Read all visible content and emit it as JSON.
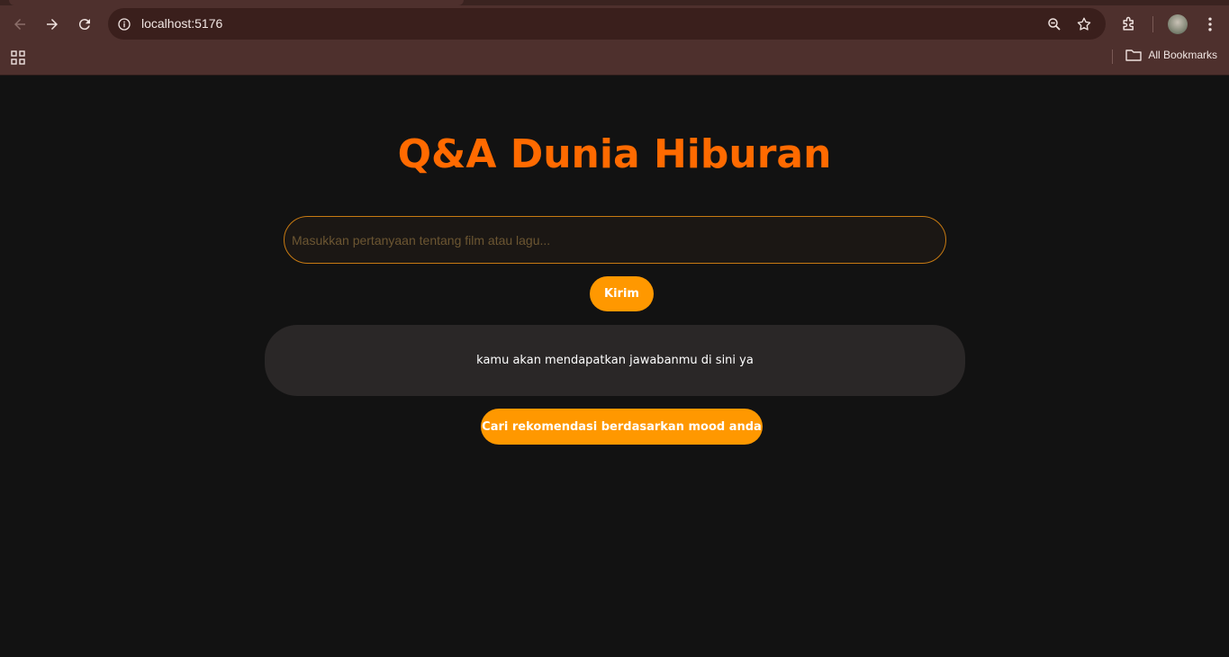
{
  "browser": {
    "url": "localhost:5176",
    "bookmarks_label": "All Bookmarks"
  },
  "page": {
    "title": "Q&A Dunia Hiburan",
    "input_placeholder": "Masukkan pertanyaan tentang film atau lagu...",
    "input_value": "",
    "send_label": "Kirim",
    "answer_text": "kamu akan mendapatkan jawabanmu di sini ya",
    "mood_button_label": "Cari rekomendasi berdasarkan mood anda"
  },
  "colors": {
    "accent": "#ff9800",
    "title": "#ff6a00",
    "background": "#121212",
    "answer_box": "#2a2727",
    "chrome": "#4e302d"
  },
  "icons": [
    "back-icon",
    "forward-icon",
    "reload-icon",
    "site-info-icon",
    "zoom-icon",
    "bookmark-star-icon",
    "extensions-icon",
    "profile-avatar",
    "menu-icon",
    "apps-icon",
    "folder-icon"
  ]
}
